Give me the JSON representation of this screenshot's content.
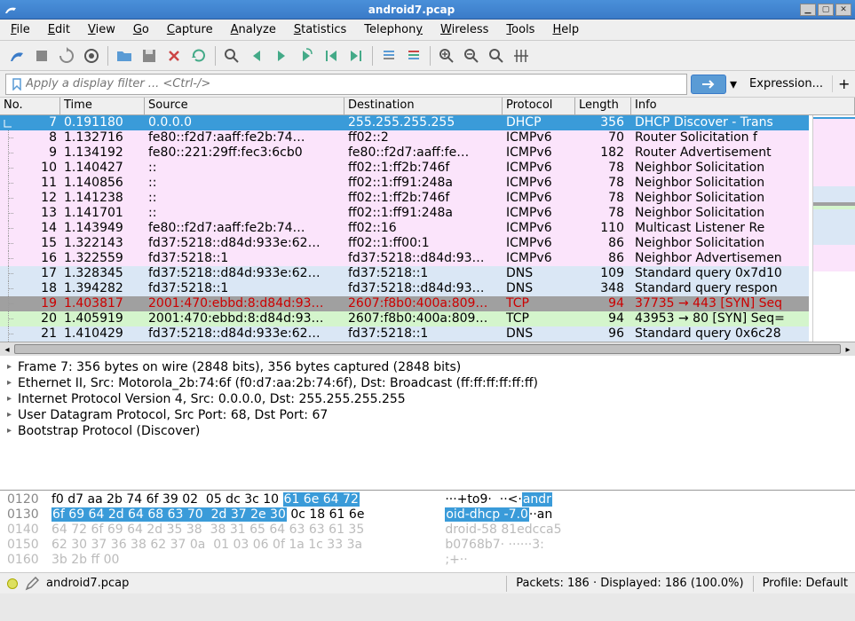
{
  "window": {
    "title": "android7.pcap"
  },
  "menu": [
    "File",
    "Edit",
    "View",
    "Go",
    "Capture",
    "Analyze",
    "Statistics",
    "Telephony",
    "Wireless",
    "Tools",
    "Help"
  ],
  "filter": {
    "placeholder": "Apply a display filter ... <Ctrl-/>",
    "expression": "Expression...",
    "plus": "+"
  },
  "columns": {
    "no": "No.",
    "time": "Time",
    "source": "Source",
    "destination": "Destination",
    "protocol": "Protocol",
    "length": "Length",
    "info": "Info"
  },
  "packets": [
    {
      "no": "7",
      "time": "0.191180",
      "src": "0.0.0.0",
      "dst": "255.255.255.255",
      "proto": "DHCP",
      "len": "356",
      "info": "DHCP Discover - Trans",
      "cls": "selected",
      "first": true
    },
    {
      "no": "8",
      "time": "1.132716",
      "src": "fe80::f2d7:aaff:fe2b:74…",
      "dst": "ff02::2",
      "proto": "ICMPv6",
      "len": "70",
      "info": "Router Solicitation f",
      "cls": "icmpv6"
    },
    {
      "no": "9",
      "time": "1.134192",
      "src": "fe80::221:29ff:fec3:6cb0",
      "dst": "fe80::f2d7:aaff:fe…",
      "proto": "ICMPv6",
      "len": "182",
      "info": "Router Advertisement",
      "cls": "icmpv6"
    },
    {
      "no": "10",
      "time": "1.140427",
      "src": "::",
      "dst": "ff02::1:ff2b:746f",
      "proto": "ICMPv6",
      "len": "78",
      "info": "Neighbor Solicitation",
      "cls": "icmpv6"
    },
    {
      "no": "11",
      "time": "1.140856",
      "src": "::",
      "dst": "ff02::1:ff91:248a",
      "proto": "ICMPv6",
      "len": "78",
      "info": "Neighbor Solicitation",
      "cls": "icmpv6"
    },
    {
      "no": "12",
      "time": "1.141238",
      "src": "::",
      "dst": "ff02::1:ff2b:746f",
      "proto": "ICMPv6",
      "len": "78",
      "info": "Neighbor Solicitation",
      "cls": "icmpv6"
    },
    {
      "no": "13",
      "time": "1.141701",
      "src": "::",
      "dst": "ff02::1:ff91:248a",
      "proto": "ICMPv6",
      "len": "78",
      "info": "Neighbor Solicitation",
      "cls": "icmpv6"
    },
    {
      "no": "14",
      "time": "1.143949",
      "src": "fe80::f2d7:aaff:fe2b:74…",
      "dst": "ff02::16",
      "proto": "ICMPv6",
      "len": "110",
      "info": "Multicast Listener Re",
      "cls": "icmpv6"
    },
    {
      "no": "15",
      "time": "1.322143",
      "src": "fd37:5218::d84d:933e:62…",
      "dst": "ff02::1:ff00:1",
      "proto": "ICMPv6",
      "len": "86",
      "info": "Neighbor Solicitation",
      "cls": "icmpv6"
    },
    {
      "no": "16",
      "time": "1.322559",
      "src": "fd37:5218::1",
      "dst": "fd37:5218::d84d:93…",
      "proto": "ICMPv6",
      "len": "86",
      "info": "Neighbor Advertisemen",
      "cls": "icmpv6"
    },
    {
      "no": "17",
      "time": "1.328345",
      "src": "fd37:5218::d84d:933e:62…",
      "dst": "fd37:5218::1",
      "proto": "DNS",
      "len": "109",
      "info": "Standard query 0x7d10",
      "cls": "dns"
    },
    {
      "no": "18",
      "time": "1.394282",
      "src": "fd37:5218::1",
      "dst": "fd37:5218::d84d:93…",
      "proto": "DNS",
      "len": "348",
      "info": "Standard query respon",
      "cls": "dns"
    },
    {
      "no": "19",
      "time": "1.403817",
      "src": "2001:470:ebbd:8:d84d:93…",
      "dst": "2607:f8b0:400a:809…",
      "proto": "TCP",
      "len": "94",
      "info": "37735 → 443 [SYN] Seq",
      "cls": "tcp-gray"
    },
    {
      "no": "20",
      "time": "1.405919",
      "src": "2001:470:ebbd:8:d84d:93…",
      "dst": "2607:f8b0:400a:809…",
      "proto": "TCP",
      "len": "94",
      "info": "43953 → 80 [SYN] Seq=",
      "cls": "tcp-green"
    },
    {
      "no": "21",
      "time": "1.410429",
      "src": "fd37:5218::d84d:933e:62…",
      "dst": "fd37:5218::1",
      "proto": "DNS",
      "len": "96",
      "info": "Standard query 0x6c28",
      "cls": "dns"
    }
  ],
  "details": [
    "Frame 7: 356 bytes on wire (2848 bits), 356 bytes captured (2848 bits)",
    "Ethernet II, Src: Motorola_2b:74:6f (f0:d7:aa:2b:74:6f), Dst: Broadcast (ff:ff:ff:ff:ff:ff)",
    "Internet Protocol Version 4, Src: 0.0.0.0, Dst: 255.255.255.255",
    "User Datagram Protocol, Src Port: 68, Dst Port: 67",
    "Bootstrap Protocol (Discover)"
  ],
  "hex": [
    {
      "off": "0120",
      "bytes_pre": "f0 d7 aa 2b 74 6f 39 02  05 dc 3c 10 ",
      "bytes_sel": "61 6e 64 72",
      "bytes_post": "",
      "ascii_pre": "···+to9·  ··<·",
      "ascii_sel": "andr",
      "ascii_post": ""
    },
    {
      "off": "0130",
      "bytes_pre": "",
      "bytes_sel": "6f 69 64 2d 64 68 63 70  2d 37 2e 30",
      "bytes_post": " 0c 18 61 6e",
      "ascii_pre": "",
      "ascii_sel": "oid-dhcp -7.0",
      "ascii_post": "··an"
    },
    {
      "off": "0140",
      "bytes_pre": "64 72 6f 69 64 2d 35 38  38 31 65 64 63 63 61 35",
      "bytes_sel": "",
      "bytes_post": "",
      "ascii_pre": "droid-58 81edcca5",
      "ascii_sel": "",
      "ascii_post": "",
      "dim": true
    },
    {
      "off": "0150",
      "bytes_pre": "62 30 37 36 38 62 37 0a  01 03 06 0f 1a 1c 33 3a",
      "bytes_sel": "",
      "bytes_post": "",
      "ascii_pre": "b0768b7· ······3:",
      "ascii_sel": "",
      "ascii_post": "",
      "dim": true
    },
    {
      "off": "0160",
      "bytes_pre": "3b 2b ff 00",
      "bytes_sel": "",
      "bytes_post": "",
      "ascii_pre": ";+··",
      "ascii_sel": "",
      "ascii_post": "",
      "dim": true
    }
  ],
  "status": {
    "file": "android7.pcap",
    "packets": "Packets: 186 · Displayed: 186 (100.0%)",
    "profile": "Profile: Default"
  }
}
